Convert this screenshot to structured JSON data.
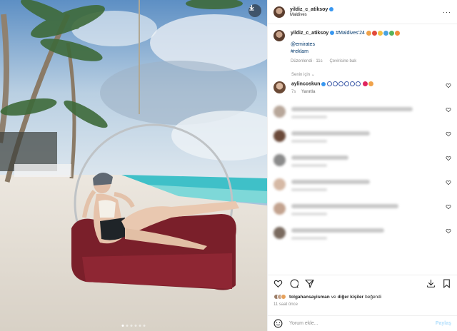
{
  "header": {
    "username": "yildiz_c_atiksoy",
    "location": "Maldives",
    "more_icon": "more-horizontal-icon"
  },
  "caption": {
    "username": "yildiz_c_atiksoy",
    "hashtag": "#Maldives'24",
    "mention": "@emirates",
    "hashtag2": "#reklam",
    "edited": "Düzenlendi · 11s",
    "translate": "Çevirisine bak"
  },
  "sort_label": "Senin için",
  "comments": [
    {
      "username": "aylincoskun",
      "meta": "7s",
      "reply": "Yanıtla",
      "blurred": false
    },
    {
      "blurred": true
    },
    {
      "blurred": true
    },
    {
      "blurred": true
    },
    {
      "blurred": true
    },
    {
      "blurred": true
    },
    {
      "blurred": true
    },
    {
      "blurred": true
    }
  ],
  "likes": {
    "user": "tolgahansayisman",
    "connector": "ve",
    "others": "diğer kişiler",
    "suffix": "beğendi"
  },
  "time_ago": "11 saat önce",
  "add_comment": {
    "placeholder": "Yorum ekle...",
    "post_label": "Paylaş"
  },
  "colors": {
    "link": "#00376b",
    "verified": "#3897f0",
    "muted": "#8e8e8e"
  }
}
